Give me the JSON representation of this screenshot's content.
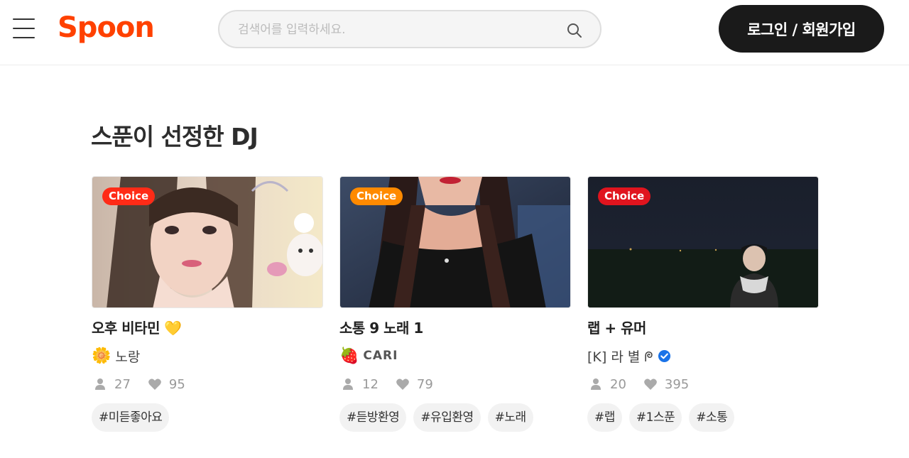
{
  "header": {
    "logo": "Spoon",
    "search_placeholder": "검색어를 입력하세요.",
    "login_label": "로그인 / 회원가입"
  },
  "section": {
    "title": "스푼이 선정한 DJ"
  },
  "cards": [
    {
      "badge": "Choice",
      "badge_color": "#ff2b17",
      "title": "오후 비타민 💛",
      "dj_emoji": "🌼",
      "dj_name": "노랑",
      "listeners": "27",
      "likes": "95",
      "tags": [
        "#미듣좋아요"
      ]
    },
    {
      "badge": "Choice",
      "badge_color": "#ff8a00",
      "title": "소통 9 노래 1",
      "dj_emoji": "🍓",
      "dj_name": "CARI",
      "listeners": "12",
      "likes": "79",
      "tags": [
        "#듣방환영",
        "#유입환영",
        "#노래"
      ]
    },
    {
      "badge": "Choice",
      "badge_color": "#e0141e",
      "title": "랩 + 유머",
      "dj_emoji": "",
      "dj_name": "[K] 라 별 ᖘ",
      "listeners": "20",
      "likes": "395",
      "tags": [
        "#랩",
        "#1스푼",
        "#소통"
      ]
    }
  ],
  "colors": {
    "brand": "#ff4100",
    "verified": "#1a73e8"
  }
}
